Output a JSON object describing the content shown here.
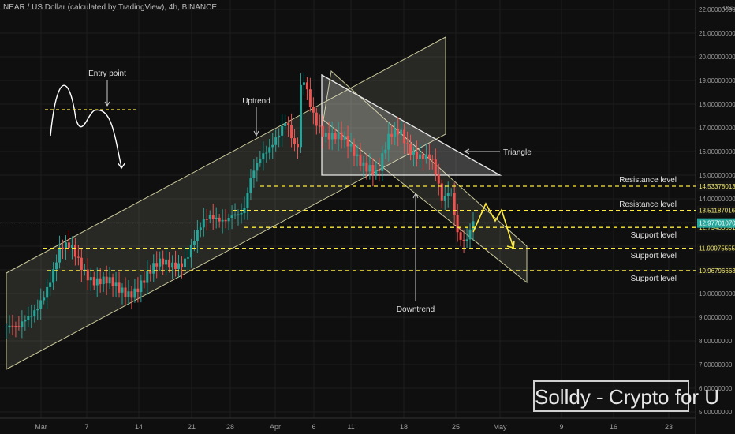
{
  "header": {
    "title": "NEAR / US Dollar (calculated by TradingView), 4h, BINANCE"
  },
  "watermark": "Solldy - Crypto for U",
  "currency": "USD",
  "chart_data": {
    "type": "candlestick",
    "title": "NEAR / US Dollar (calculated by TradingView), 4h, BINANCE",
    "x_ticks": [
      "Mar",
      "7",
      "14",
      "21",
      "28",
      "Apr",
      "6",
      "11",
      "18",
      "25",
      "May",
      "9",
      "16",
      "23"
    ],
    "y_ticks": [
      "5.00000000",
      "6.00000000",
      "7.00000000",
      "8.00000000",
      "9.00000000",
      "10.00000000",
      "11.00000000",
      "12.00000000",
      "13.00000000",
      "14.00000000",
      "15.00000000",
      "16.00000000",
      "17.00000000",
      "18.00000000",
      "19.00000000",
      "20.00000000",
      "21.00000000",
      "22.00000000"
    ],
    "ylim": [
      5,
      22
    ],
    "price_series": [
      [
        0,
        8.6
      ],
      [
        1.5,
        8.2
      ],
      [
        3,
        9.0
      ],
      [
        4.5,
        10.0
      ],
      [
        6,
        10.8
      ],
      [
        7,
        11.6
      ],
      [
        8.5,
        11.8
      ],
      [
        10,
        11.3
      ],
      [
        11.5,
        10.7
      ],
      [
        13,
        10.3
      ],
      [
        14.5,
        10.0
      ],
      [
        16,
        10.2
      ],
      [
        17.5,
        10.6
      ],
      [
        19,
        10.8
      ],
      [
        20.5,
        11.1
      ],
      [
        22,
        11.4
      ],
      [
        23.5,
        11.7
      ],
      [
        25,
        12.4
      ],
      [
        26.5,
        13.0
      ],
      [
        28,
        13.3
      ],
      [
        29.5,
        13.6
      ],
      [
        31,
        13.2
      ],
      [
        32,
        14.6
      ],
      [
        33.5,
        15.9
      ],
      [
        35,
        16.8
      ],
      [
        36.5,
        17.3
      ],
      [
        38,
        15.5
      ],
      [
        38.6,
        19.1
      ],
      [
        40,
        17.8
      ],
      [
        41.5,
        17.0
      ],
      [
        43,
        16.5
      ],
      [
        44.5,
        16.1
      ],
      [
        46,
        15.8
      ],
      [
        47.5,
        15.6
      ],
      [
        48.5,
        15.1
      ],
      [
        50,
        16.3
      ],
      [
        51.5,
        16.8
      ],
      [
        52.5,
        16.4
      ],
      [
        54,
        16.0
      ],
      [
        55.5,
        15.5
      ],
      [
        57,
        13.6
      ],
      [
        58,
        14.6
      ],
      [
        59,
        12.8
      ],
      [
        60,
        12.4
      ],
      [
        61,
        12.98
      ]
    ],
    "levels": [
      {
        "value": 14.53378013,
        "label": "Resistance level",
        "price_label": "14.53378013"
      },
      {
        "value": 13.51187016,
        "label": "Resistance level",
        "price_label": "13.51187016"
      },
      {
        "value": 12.79435891,
        "label": "Support level",
        "price_label": "12.79435891"
      },
      {
        "value": 11.90975555,
        "label": "Support level",
        "price_label": "11.90975555"
      },
      {
        "value": 10.96796663,
        "label": "Support level",
        "price_label": "10.96796663"
      }
    ],
    "current_price": {
      "value": 12.97701,
      "label": "12.97701070"
    },
    "annotations": [
      "Entry point",
      "Uptrend",
      "Triangle",
      "Downtrend"
    ]
  },
  "colors": {
    "background": "#0f0f0f",
    "candle_up": "#26a69a",
    "candle_down": "#ef5350",
    "levels": "#ffeb3b",
    "channel": "#c9c79a",
    "price_tag": "#26a69a"
  }
}
